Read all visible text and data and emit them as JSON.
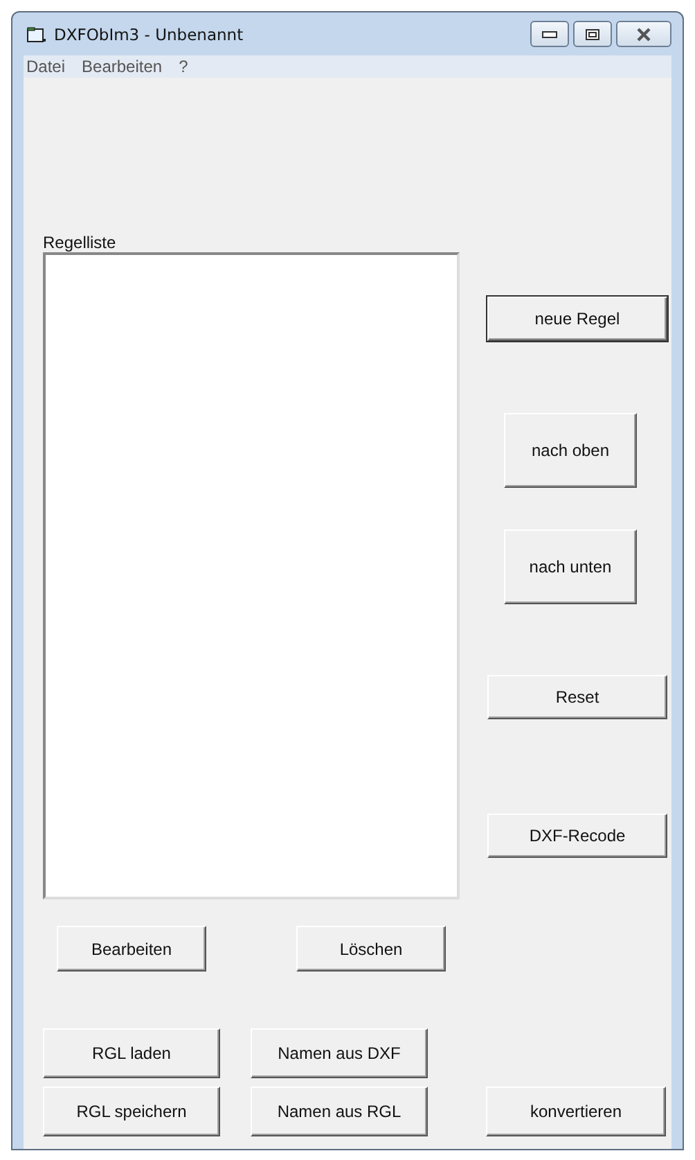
{
  "window": {
    "title": "DXFObIm3 - Unbenannt"
  },
  "menu": [
    "Datei",
    "Bearbeiten",
    "?"
  ],
  "rule_list": {
    "label": "Regelliste"
  },
  "side_buttons": [
    {
      "label": "neue Regel",
      "default": true,
      "kind": "wide"
    },
    {
      "label": "nach oben",
      "default": false,
      "kind": "tall"
    },
    {
      "label": "nach unten",
      "default": false,
      "kind": "tall"
    },
    {
      "label": "Reset",
      "default": false,
      "kind": "wide"
    },
    {
      "label": "DXF-Recode",
      "default": false,
      "kind": "wide"
    }
  ],
  "list_buttons": [
    "Bearbeiten",
    "Löschen"
  ],
  "bottom_buttons": [
    [
      "RGL laden",
      "Namen aus DXF"
    ],
    [
      "RGL speichern",
      "Namen aus RGL",
      "konvertieren"
    ]
  ]
}
